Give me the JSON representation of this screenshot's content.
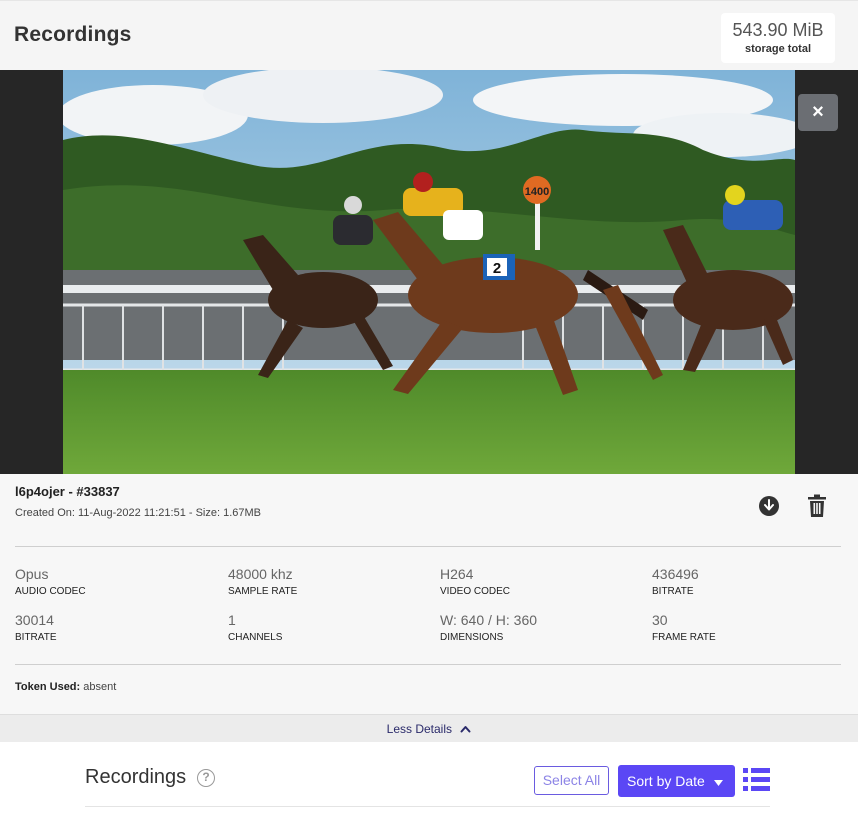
{
  "header": {
    "title": "Recordings",
    "storage_value": "543.90 MiB",
    "storage_label": "storage total"
  },
  "player": {
    "close_label": "×"
  },
  "recording": {
    "name": "l6p4ojer - #33837",
    "meta": "Created On: 11-Aug-2022 11:21:51 - Size: 1.67MB"
  },
  "specs": [
    {
      "value": "Opus",
      "label": "AUDIO CODEC"
    },
    {
      "value": "48000 khz",
      "label": "SAMPLE RATE"
    },
    {
      "value": "H264",
      "label": "VIDEO CODEC"
    },
    {
      "value": "436496",
      "label": "BITRATE"
    },
    {
      "value": "30014",
      "label": "BITRATE"
    },
    {
      "value": "1",
      "label": "CHANNELS"
    },
    {
      "value": "W: 640 / H: 360",
      "label": "DIMENSIONS"
    },
    {
      "value": "30",
      "label": "FRAME RATE"
    }
  ],
  "token": {
    "label": "Token Used:",
    "value": "absent"
  },
  "details_toggle": {
    "label": "Less Details"
  },
  "list": {
    "title": "Recordings",
    "help": "?",
    "select_all": "Select All",
    "sort_label": "Sort by Date"
  },
  "video_overlay": {
    "post_sign": "1400",
    "saddle_number": "2"
  },
  "colors": {
    "accent": "#5b47f5",
    "select_all_border": "#6a5be0",
    "header_bg": "#f5f5f5",
    "details_bg": "#f7f7f7"
  },
  "icons": {
    "close": "close-icon",
    "download": "download-circle-icon",
    "delete": "trash-icon",
    "help": "question-circle-icon",
    "toggle": "chevron-up-icon",
    "sort": "caret-down-icon",
    "view": "list-view-icon"
  }
}
